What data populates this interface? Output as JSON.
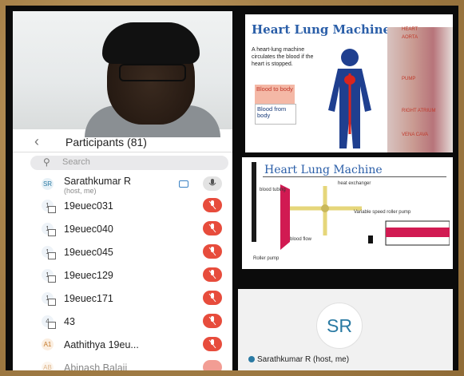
{
  "participants_title": "Participants (81)",
  "search_placeholder": "Search",
  "host": {
    "initials": "SR",
    "name": "Sarathkumar R",
    "role": "(host, me)"
  },
  "participants": [
    {
      "badge": "1",
      "name": "19euec031"
    },
    {
      "badge": "1",
      "name": "19euec040"
    },
    {
      "badge": "1",
      "name": "19euec045"
    },
    {
      "badge": "1",
      "name": "19euec129"
    },
    {
      "badge": "1",
      "name": "19euec171"
    },
    {
      "badge": "4",
      "name": "43"
    },
    {
      "badge": "A1",
      "name": "Aathithya 19eu..."
    },
    {
      "badge": "AB",
      "name": "Abinash Balaji"
    }
  ],
  "slide1": {
    "title": "Heart Lung Machine",
    "text": "A heart-lung machine circulates the blood if the heart is stopped.",
    "label_to": "Blood to body",
    "label_from": "Blood from body",
    "right_labels": [
      "HEART",
      "AORTA",
      "PUMP",
      "RIGHT ATRIUM",
      "VENA CAVA"
    ]
  },
  "slide2": {
    "title": "Heart Lung Machine",
    "labels": [
      "blood tubing",
      "heat exchanger",
      "Variable speed roller pump",
      "blood flow",
      "Roller pump"
    ]
  },
  "gallery": {
    "initials": "SR",
    "label": "Sarathkumar R (host, me)"
  },
  "colors": {
    "mic_red": "#e74c3c",
    "accent_blue": "#2a7aa3",
    "slide_title": "#2a5ea8"
  }
}
